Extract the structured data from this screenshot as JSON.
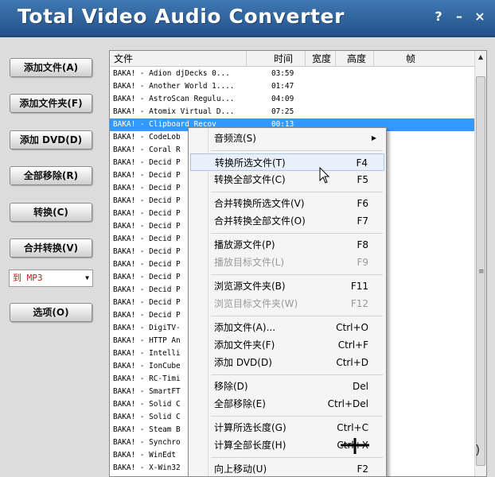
{
  "app": {
    "title": "Total Video Audio Converter"
  },
  "window_buttons": {
    "help": "?",
    "minimize": "–",
    "close": "×"
  },
  "sidebar": {
    "buttons": [
      "添加文件(A)",
      "添加文件夹(F)",
      "添加 DVD(D)",
      "全部移除(R)",
      "转换(C)",
      "合并转换(V)",
      "选项(O)"
    ],
    "format_select": "到 MP3"
  },
  "table": {
    "headers": {
      "file": "文件",
      "time": "时间",
      "width": "宽度",
      "height": "高度",
      "frame": "帧"
    },
    "rows": [
      {
        "name": "BAKA! - Adion djDecks 0...",
        "time": "03:59"
      },
      {
        "name": "BAKA! - Another World 1....",
        "time": "01:47"
      },
      {
        "name": "BAKA! - AstroScan Regulu...",
        "time": "04:09"
      },
      {
        "name": "BAKA! - Atomix Virtual D...",
        "time": "07:25"
      },
      {
        "name": "BAKA! - Clipboard Recov",
        "time": "00:13",
        "selected": true
      },
      {
        "name": "BAKA! - CodeLob",
        "time": ""
      },
      {
        "name": "BAKA! - Coral R",
        "time": ""
      },
      {
        "name": "BAKA! - Decid P",
        "time": ""
      },
      {
        "name": "BAKA! - Decid P",
        "time": ""
      },
      {
        "name": "BAKA! - Decid P",
        "time": ""
      },
      {
        "name": "BAKA! - Decid P",
        "time": ""
      },
      {
        "name": "BAKA! - Decid P",
        "time": ""
      },
      {
        "name": "BAKA! - Decid P",
        "time": ""
      },
      {
        "name": "BAKA! - Decid P",
        "time": ""
      },
      {
        "name": "BAKA! - Decid P",
        "time": ""
      },
      {
        "name": "BAKA! - Decid P",
        "time": ""
      },
      {
        "name": "BAKA! - Decid P",
        "time": ""
      },
      {
        "name": "BAKA! - Decid P",
        "time": ""
      },
      {
        "name": "BAKA! - Decid P",
        "time": ""
      },
      {
        "name": "BAKA! - Decid P",
        "time": ""
      },
      {
        "name": "BAKA! - DigiTV-",
        "time": ""
      },
      {
        "name": "BAKA! - HTTP An",
        "time": ""
      },
      {
        "name": "BAKA! - Intelli",
        "time": ""
      },
      {
        "name": "BAKA! - IonCube",
        "time": ""
      },
      {
        "name": "BAKA! - RC-Timi",
        "time": ""
      },
      {
        "name": "BAKA! - SmartFT",
        "time": ""
      },
      {
        "name": "BAKA! - Solid C",
        "time": ""
      },
      {
        "name": "BAKA! - Solid C",
        "time": ""
      },
      {
        "name": "BAKA! - Steam B",
        "time": ""
      },
      {
        "name": "BAKA! - Synchro",
        "time": ""
      },
      {
        "name": "BAKA! - WinEdt",
        "time": ""
      },
      {
        "name": "BAKA! - X-Win32",
        "time": ""
      }
    ]
  },
  "context_menu": {
    "items": [
      {
        "label": "音频流(S)",
        "key": "",
        "submenu": true
      },
      {
        "label": "转换所选文件(T)",
        "key": "F4",
        "hover": true
      },
      {
        "label": "转换全部文件(C)",
        "key": "F5"
      },
      {
        "label": "合并转换所选文件(V)",
        "key": "F6"
      },
      {
        "label": "合并转换全部文件(O)",
        "key": "F7"
      },
      {
        "label": "播放源文件(P)",
        "key": "F8"
      },
      {
        "label": "播放目标文件(L)",
        "key": "F9",
        "disabled": true
      },
      {
        "label": "浏览源文件夹(B)",
        "key": "F11"
      },
      {
        "label": "浏览目标文件夹(W)",
        "key": "F12",
        "disabled": true
      },
      {
        "label": "添加文件(A)...",
        "key": "Ctrl+O"
      },
      {
        "label": "添加文件夹(F)",
        "key": "Ctrl+F"
      },
      {
        "label": "添加 DVD(D)",
        "key": "Ctrl+D"
      },
      {
        "label": "移除(D)",
        "key": "Del"
      },
      {
        "label": "全部移除(E)",
        "key": "Ctrl+Del"
      },
      {
        "label": "计算所选长度(G)",
        "key": "Ctrl+C"
      },
      {
        "label": "计算全部长度(H)",
        "key": "Ctrl+X"
      },
      {
        "label": "向上移动(U)",
        "key": "F2"
      }
    ]
  },
  "colors": {
    "titlebar": "#2f6aa6",
    "selection": "#3399ff",
    "menu_bg": "#f5f5f5"
  }
}
